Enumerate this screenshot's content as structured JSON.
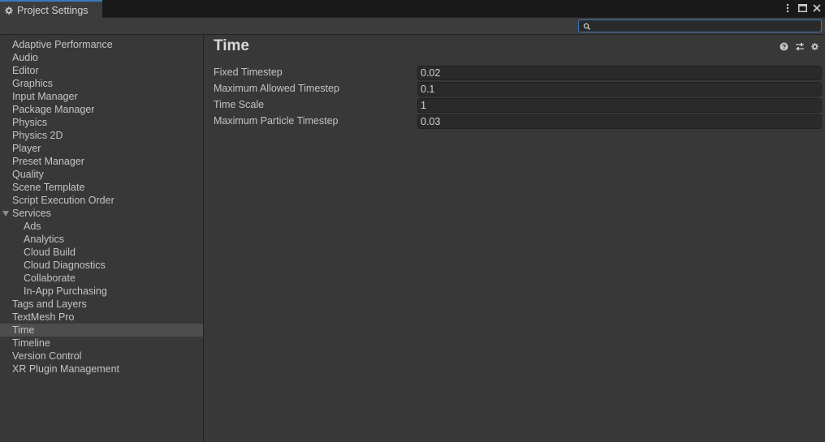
{
  "window": {
    "tab_title": "Project Settings",
    "tab_icon": "gear-icon",
    "controls": [
      "kebab-menu-icon",
      "maximize-icon",
      "close-icon"
    ]
  },
  "search": {
    "value": "",
    "placeholder": ""
  },
  "sidebar": {
    "items": [
      {
        "label": "Adaptive Performance"
      },
      {
        "label": "Audio"
      },
      {
        "label": "Editor"
      },
      {
        "label": "Graphics"
      },
      {
        "label": "Input Manager"
      },
      {
        "label": "Package Manager"
      },
      {
        "label": "Physics"
      },
      {
        "label": "Physics 2D"
      },
      {
        "label": "Player"
      },
      {
        "label": "Preset Manager"
      },
      {
        "label": "Quality"
      },
      {
        "label": "Scene Template"
      },
      {
        "label": "Script Execution Order"
      },
      {
        "label": "Services",
        "expanded": true
      },
      {
        "label": "Ads",
        "child": true
      },
      {
        "label": "Analytics",
        "child": true
      },
      {
        "label": "Cloud Build",
        "child": true
      },
      {
        "label": "Cloud Diagnostics",
        "child": true
      },
      {
        "label": "Collaborate",
        "child": true
      },
      {
        "label": "In-App Purchasing",
        "child": true
      },
      {
        "label": "Tags and Layers"
      },
      {
        "label": "TextMesh Pro"
      },
      {
        "label": "Time",
        "selected": true
      },
      {
        "label": "Timeline"
      },
      {
        "label": "Version Control"
      },
      {
        "label": "XR Plugin Management"
      }
    ]
  },
  "main": {
    "title": "Time",
    "header_icons": [
      "help-icon",
      "preset-icon",
      "settings-icon"
    ],
    "fields": [
      {
        "label": "Fixed Timestep",
        "value": "0.02"
      },
      {
        "label": "Maximum Allowed Timestep",
        "value": "0.1"
      },
      {
        "label": "Time Scale",
        "value": "1"
      },
      {
        "label": "Maximum Particle Timestep",
        "value": "0.03"
      }
    ]
  },
  "colors": {
    "accent": "#3a79bb",
    "background": "#383838",
    "selected_row": "#4d4d4d",
    "field_bg": "#2a2a2a"
  }
}
